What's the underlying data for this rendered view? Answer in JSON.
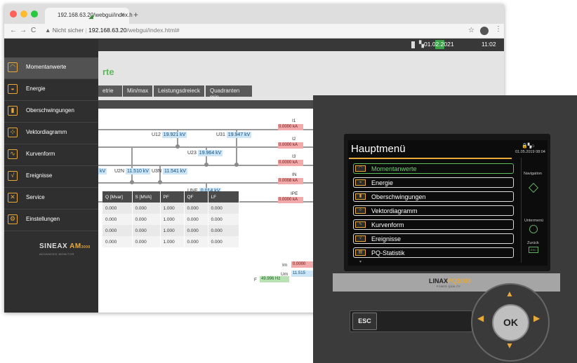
{
  "browser": {
    "tab_title": "192.168.63.20/webgui/index.h",
    "tab_close": "×",
    "new_tab": "+",
    "nav_back": "←",
    "nav_forward": "→",
    "nav_reload": "C",
    "security_text": "▲ Nicht sicher",
    "url_host": "192.168.63.20",
    "url_path": "/webgui/index.html#",
    "bookmark": "☆",
    "menu": "⋮"
  },
  "app": {
    "date": "01.02.2021",
    "time": "11:02",
    "page_title": "rte",
    "tabs": [
      "etrie",
      "Min/max",
      "Leistungsdreieck",
      "Quadranten min"
    ]
  },
  "sidebar": {
    "items": [
      {
        "label": "Momentanwerte",
        "icon": "gauge-icon",
        "glyph": "◠"
      },
      {
        "label": "Energie",
        "icon": "energy-meter-icon",
        "glyph": "◒"
      },
      {
        "label": "Oberschwingungen",
        "icon": "harmonics-bars-icon",
        "glyph": "▮"
      },
      {
        "label": "Vektordiagramm",
        "icon": "vector-diagram-icon",
        "glyph": "⊹"
      },
      {
        "label": "Kurvenform",
        "icon": "waveform-icon",
        "glyph": "∿"
      },
      {
        "label": "Ereignisse",
        "icon": "events-icon",
        "glyph": "√"
      },
      {
        "label": "Service",
        "icon": "tools-icon",
        "glyph": "✕"
      },
      {
        "label": "Einstellungen",
        "icon": "gear-icon",
        "glyph": "⚙"
      }
    ],
    "brand_main": "SINEAX",
    "brand_model": "AM",
    "brand_model_num": "3000",
    "brand_sub": "ADVANCED MONITOR"
  },
  "diagram": {
    "u12_label": "U12",
    "u12": "19.921 kV",
    "u31_label": "U31",
    "u31": "19.947 kV",
    "u23_label": "U23",
    "u23": "19.964 kV",
    "kv_frag": "kV",
    "u2n_label": "U2N",
    "u2n": "11.510 kV",
    "u3n_label": "U3N",
    "u3n": "11.541 kV",
    "une_label": "UNE",
    "une": "0.014 kV",
    "i1_label": "I1",
    "i1": "0.0000 kA",
    "i2_label": "I2",
    "i2": "0.0000 kA",
    "i3_label": "I3",
    "i3": "0.0000 kA",
    "in_label": "IN",
    "in": "0.0008 kA",
    "ipe_label": "IPE",
    "ipe": "0.0000 kA",
    "f_label": "F",
    "f": "49.996 Hz",
    "im_label": "Im",
    "im": "0.0000",
    "um_label": "Um",
    "um": "11.515"
  },
  "table": {
    "headers": [
      "Q [Mvar]",
      "S [MVA]",
      "PF",
      "QF",
      "LF"
    ],
    "rows": [
      [
        "0.000",
        "0.000",
        "1.000",
        "0.000",
        "0.000"
      ],
      [
        "0.000",
        "0.000",
        "1.000",
        "0.000",
        "0.000"
      ],
      [
        "0.000",
        "0.000",
        "1.000",
        "0.000",
        "0.000"
      ],
      [
        "0.000",
        "0.000",
        "1.000",
        "0.000",
        "0.000"
      ]
    ]
  },
  "device": {
    "title": "Hauptmenü",
    "date": "01.05.2019",
    "time": "08:04",
    "status_icons": "🔒▚⌂",
    "menu": [
      {
        "label": "Momentanwerte",
        "icon": "gauge-icon",
        "glyph": "◠"
      },
      {
        "label": "Energie",
        "icon": "energy-meter-icon",
        "glyph": "◒"
      },
      {
        "label": "Oberschwingungen",
        "icon": "harmonics-bars-icon",
        "glyph": "▮"
      },
      {
        "label": "Vektordiagramm",
        "icon": "vector-diagram-icon",
        "glyph": "⊹"
      },
      {
        "label": "Kurvenform",
        "icon": "waveform-icon",
        "glyph": "∿"
      },
      {
        "label": "Ereignisse",
        "icon": "events-icon",
        "glyph": "√"
      },
      {
        "label": "PQ-Statistik",
        "icon": "statistics-icon",
        "glyph": "▤"
      }
    ],
    "more": "▾",
    "right_nav": "Navigation",
    "right_exit": "Untermenü",
    "right_back": "Zurück",
    "right_esc": "ESC",
    "brand_main": "LINAX",
    "brand_pq": "PQ3000",
    "brand_sub": "POWER QUALITY",
    "esc": "ESC",
    "ok": "OK",
    "up": "▲",
    "down": "▼",
    "left": "◀",
    "right": "▶"
  },
  "colors": {
    "accent": "#e8a93a",
    "green": "#5cb85c"
  }
}
